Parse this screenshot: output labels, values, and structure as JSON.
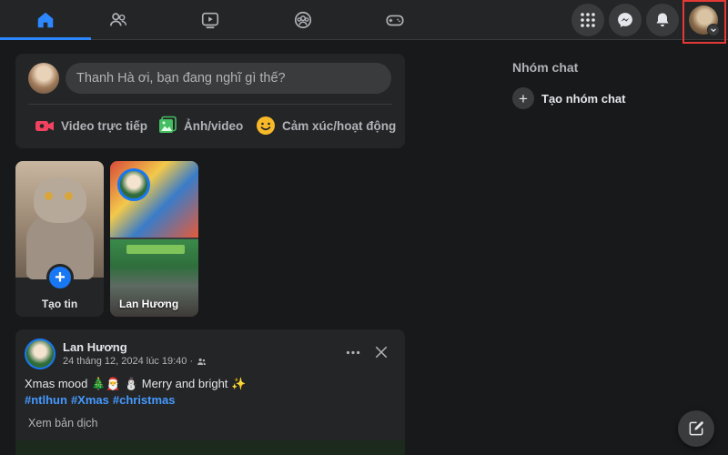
{
  "nav": {
    "tabs": [
      {
        "name": "home",
        "icon": "home-icon",
        "active": true
      },
      {
        "name": "friends",
        "icon": "friends-icon",
        "active": false
      },
      {
        "name": "watch",
        "icon": "video-icon",
        "active": false
      },
      {
        "name": "groups",
        "icon": "groups-icon",
        "active": false
      },
      {
        "name": "gaming",
        "icon": "gamepad-icon",
        "active": false
      }
    ],
    "right_buttons": [
      "menu-grid-icon",
      "messenger-icon",
      "bell-icon",
      "account-avatar"
    ],
    "highlight_color": "#e53935"
  },
  "composer": {
    "placeholder": "Thanh Hà ơi, bạn đang nghĩ gì thế?",
    "actions": [
      {
        "label": "Video trực tiếp",
        "icon": "live-video-icon",
        "color": "#f3425f"
      },
      {
        "label": "Ảnh/video",
        "icon": "photo-icon",
        "color": "#45bd62"
      },
      {
        "label": "Cảm xúc/hoạt động",
        "icon": "smile-icon",
        "color": "#f7b928"
      }
    ]
  },
  "stories": {
    "create_label": "Tạo tin",
    "items": [
      {
        "name": "Lan Hương"
      }
    ]
  },
  "post": {
    "author": "Lan Hương",
    "timestamp": "24 tháng 12, 2024 lúc 19:40 ·",
    "audience_icon": "friends-audience-icon",
    "text": "Xmas mood 🎄🎅 ⛄ Merry and bright ✨",
    "hashtags": [
      "#ntlhun",
      "#Xmas",
      "#christmas"
    ],
    "translate_label": "Xem bản dịch"
  },
  "chat": {
    "title": "Nhóm chat",
    "new_group_label": "Tạo nhóm chat"
  },
  "colors": {
    "accent": "#1877f2",
    "link": "#4599ff",
    "background": "#18191a",
    "surface": "#242526"
  }
}
